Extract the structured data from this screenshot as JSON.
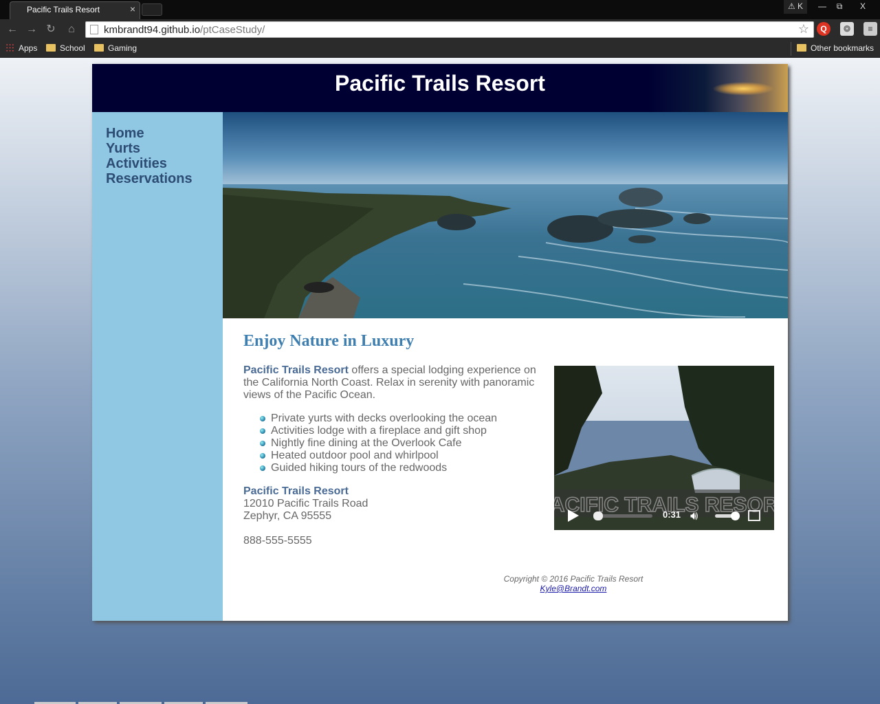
{
  "browser": {
    "tab_title": "Pacific Trails Resort",
    "tab_close": "×",
    "window_alert": "⚠ K",
    "window_min": "—",
    "window_max": "⧉",
    "window_close": "X",
    "url_host": "kmbrandt94.github.io",
    "url_path": "/ptCaseStudy/",
    "extension_q": "Q",
    "bookmarks": {
      "apps": "Apps",
      "school": "School",
      "gaming": "Gaming",
      "other": "Other bookmarks"
    }
  },
  "site": {
    "title": "Pacific Trails Resort",
    "nav": [
      "Home",
      "Yurts",
      "Activities",
      "Reservations"
    ],
    "heading": "Enjoy Nature in Luxury",
    "intro_brand": "Pacific Trails Resort",
    "intro_text": " offers a special lodging experience on the California North Coast. Relax in serenity with panoramic views of the Pacific Ocean.",
    "features": [
      "Private yurts with decks overlooking the ocean",
      "Activities lodge with a fireplace and gift shop",
      "Nightly fine dining at the Overlook Cafe",
      "Heated outdoor pool and whirlpool",
      "Guided hiking tours of the redwoods"
    ],
    "address_name": "Pacific Trails Resort",
    "address_street": "12010 Pacific Trails Road",
    "address_city": "Zephyr, CA 95555",
    "phone": "888-555-5555",
    "video": {
      "time": "0:31",
      "overlay_text": "PACIFIC TRAILS RESORT",
      "seek_progress": 0.04,
      "volume_level": 1.0
    },
    "copyright": "Copyright © 2016 Pacific Trails Resort",
    "email": "Kyle@Brandt.com"
  },
  "colors": {
    "header_bg": "#000033",
    "sidebar_bg": "#90c7e3",
    "nav_text": "#2c4c74",
    "heading": "#3f7fb0",
    "brand": "#4a6b96"
  }
}
